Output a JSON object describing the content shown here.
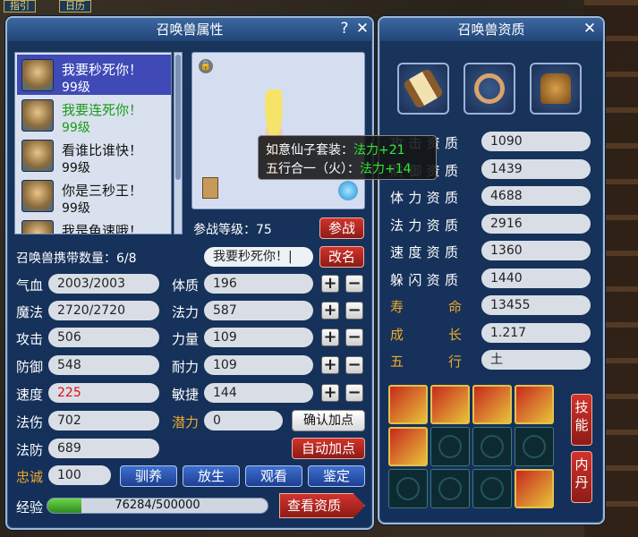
{
  "top_tabs": [
    "指引",
    "日历"
  ],
  "left_panel": {
    "title": "召唤兽属性",
    "help": "?",
    "close": "✕",
    "pets": [
      {
        "name": "我要秒死你！",
        "level": "99级",
        "state": "selected"
      },
      {
        "name": "我要连死你！",
        "level": "99级",
        "state": "green"
      },
      {
        "name": "看谁比谁快！",
        "level": "99级",
        "state": "normal"
      },
      {
        "name": "你是三秒王！",
        "level": "99级",
        "state": "normal"
      },
      {
        "name": "我是龟速哦！",
        "level": "",
        "state": "normal"
      }
    ],
    "tooltip": {
      "line1_label": "如意仙子套装：",
      "line1_value": "法力+21",
      "line2_label": "五行合一（火）：",
      "line2_value": "法力+14"
    },
    "battle_level_label": "参战等级：75",
    "battle_button": "参战",
    "carry_label": "召唤兽携带数量：6/8",
    "name_value": "我要秒死你！|",
    "rename_button": "改名",
    "stats_left": [
      {
        "label": "气血",
        "value": "2003/2003"
      },
      {
        "label": "魔法",
        "value": "2720/2720"
      },
      {
        "label": "攻击",
        "value": "506"
      },
      {
        "label": "防御",
        "value": "548"
      },
      {
        "label": "速度",
        "value": "225"
      },
      {
        "label": "法伤",
        "value": "702"
      },
      {
        "label": "法防",
        "value": "689"
      },
      {
        "label": "忠诚",
        "value": "100"
      }
    ],
    "stats_right": [
      {
        "label": "体质",
        "value": "196"
      },
      {
        "label": "法力",
        "value": "587"
      },
      {
        "label": "力量",
        "value": "109"
      },
      {
        "label": "耐力",
        "value": "109"
      },
      {
        "label": "敏捷",
        "value": "144"
      },
      {
        "label": "潜力",
        "value": "0"
      }
    ],
    "plus": "+",
    "minus": "−",
    "confirm_points": "确认加点",
    "auto_points": "自动加点",
    "actions": [
      "驯养",
      "放生",
      "观看",
      "鉴定"
    ],
    "exp_label": "经验",
    "exp_text": "76284/500000",
    "exp_fraction": 0.1526,
    "view_aptitude": "查看资质"
  },
  "right_panel": {
    "title": "召唤兽资质",
    "close": "✕",
    "equipment": [
      "scroll-icon",
      "ring-icon",
      "armor-icon"
    ],
    "aptitudes": [
      {
        "label": "攻击资质",
        "value": "1090",
        "gold": false
      },
      {
        "label": "防御资质",
        "value": "1439",
        "gold": false
      },
      {
        "label": "体力资质",
        "value": "4688",
        "gold": false
      },
      {
        "label": "法力资质",
        "value": "2916",
        "gold": false
      },
      {
        "label": "速度资质",
        "value": "1360",
        "gold": false
      },
      {
        "label": "躲闪资质",
        "value": "1440",
        "gold": false
      },
      {
        "label": "寿命",
        "value": "13455",
        "gold": true
      },
      {
        "label": "成长",
        "value": "1.217",
        "gold": true
      },
      {
        "label": "五行",
        "value": "土",
        "gold": true
      }
    ],
    "skills_button": "技能",
    "neidan_button": "内丹"
  }
}
